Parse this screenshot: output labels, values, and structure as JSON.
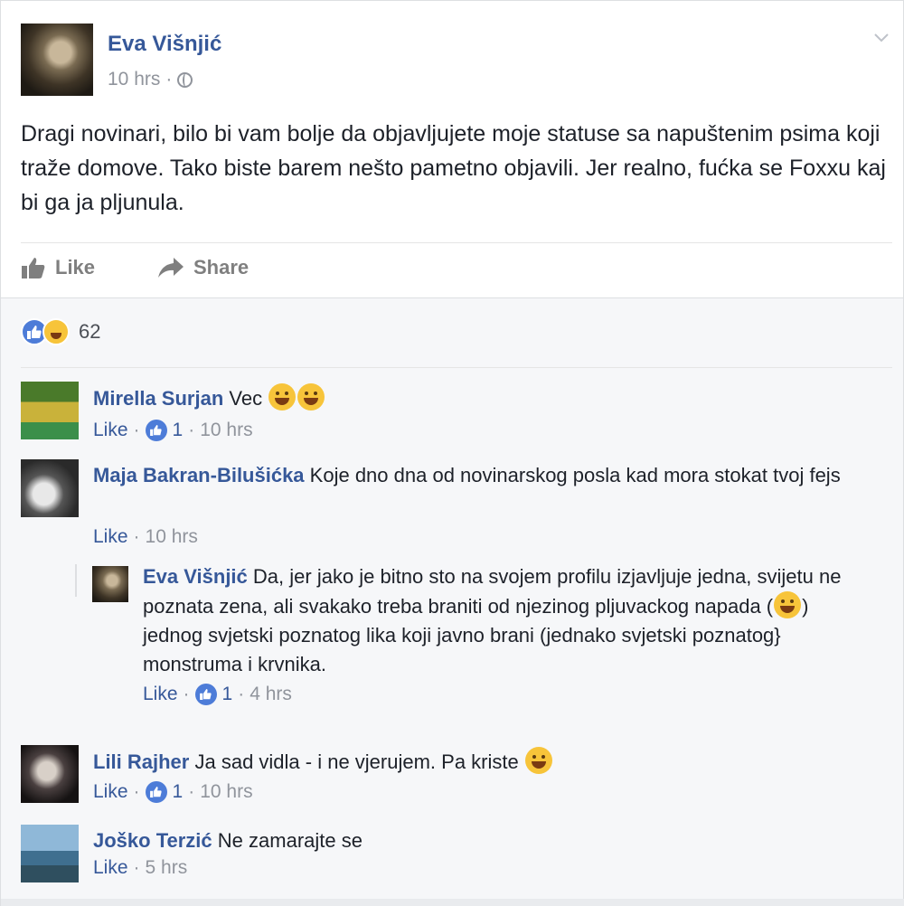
{
  "post": {
    "author": "Eva Višnjić",
    "time": "10 hrs",
    "separator": "·",
    "text": "Dragi novinari, bilo bi vam bolje da objavljujete moje statuse sa napuštenim psima koji traže domove. Tako biste barem nešto pametno objavili. Jer realno, fućka se Foxxu kaj bi ga ja pljunula.",
    "actions": {
      "like": "Like",
      "share": "Share"
    },
    "reaction_count": "62"
  },
  "comments": [
    {
      "name": "Mirella Surjan",
      "text": "Vec",
      "like": "Like",
      "likes": "1",
      "time": "10 hrs"
    },
    {
      "name": "Maja Bakran-Bilušićka",
      "text": "Koje dno dna od novinarskog posla kad mora stokat tvoj fejs",
      "like": "Like",
      "time": "10 hrs"
    },
    {
      "name": "Eva Višnjić",
      "text_a": "Da, jer jako je bitno sto na svojem profilu izjavljuje jedna, svijetu ne poznata zena, ali svakako treba braniti od njezinog pljuvackog napada (",
      "text_b": ") jednog svjetski poznatog lika koji javno brani (jednako svjetski poznatog} monstruma i krvnika.",
      "like": "Like",
      "likes": "1",
      "time": "4 hrs"
    },
    {
      "name": "Lili Rajher",
      "text": "Ja sad vidla - i ne vjerujem. Pa kriste",
      "like": "Like",
      "likes": "1",
      "time": "10 hrs"
    },
    {
      "name": "Joško Terzić",
      "text": "Ne zamarajte se",
      "like": "Like",
      "time": "5 hrs"
    }
  ],
  "colors": {
    "link": "#365899",
    "muted": "#90949c",
    "like_blue": "#4d7cd8",
    "emoji_yellow": "#f7c43a",
    "comments_bg": "#f6f7f9"
  },
  "icons": [
    "globe-icon",
    "chevron-down-icon",
    "like-icon",
    "share-icon",
    "haha-icon",
    "grinning-emoji"
  ]
}
